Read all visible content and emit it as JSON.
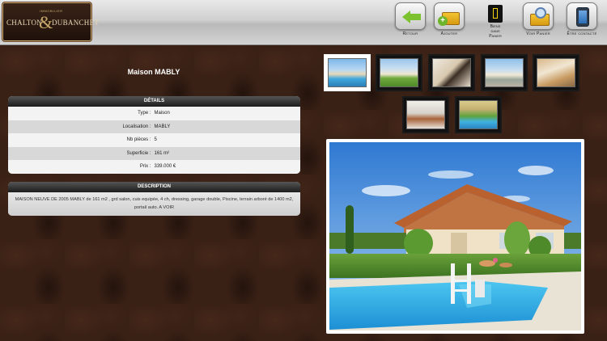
{
  "logo": {
    "small": "IMMOBILIER",
    "name_left": "CHALTON",
    "amp": "&",
    "name_right": "DUBANCHET"
  },
  "nav": [
    {
      "label": "Retour",
      "icon": "back-arrow-icon"
    },
    {
      "label": "Ajouter",
      "icon": "add-to-basket-icon"
    },
    {
      "label1": "Biens",
      "label2": "dans",
      "label3": "Panier",
      "icon": "basket-count-tag-icon"
    },
    {
      "label": "Voir Panier",
      "icon": "view-basket-icon"
    },
    {
      "label": "Être contacté",
      "icon": "contact-tablet-icon"
    }
  ],
  "property": {
    "title": "Maison MABLY"
  },
  "details": {
    "header": "DÉTAILS",
    "rows": [
      {
        "key": "Type :",
        "value": "Maison"
      },
      {
        "key": "Localisation :",
        "value": "MABLY"
      },
      {
        "key": "Nb pièces :",
        "value": "5"
      },
      {
        "key": "Superficie :",
        "value": "161 m²"
      },
      {
        "key": "Prix :",
        "value": "339.000 €"
      }
    ]
  },
  "description": {
    "header": "DESCRIPTION",
    "text": "MAISON NEUVE DE 2005 MABLY de 161 m2 , grd salon, cuis equipée, 4 ch, dressing, garage double, Piscine, terrain arboré de 1400 m2, portail auto. A VOIR"
  },
  "gallery": {
    "thumbnails": [
      "exterior-pool",
      "house-lawn",
      "living-room",
      "house-driveway",
      "bedroom",
      "kitchen",
      "pool-terrace"
    ],
    "active_index": 0
  },
  "colors": {
    "accent_green": "#7cc22e",
    "brand_gold": "#c9a96b",
    "bg_brown": "#3a2116"
  }
}
